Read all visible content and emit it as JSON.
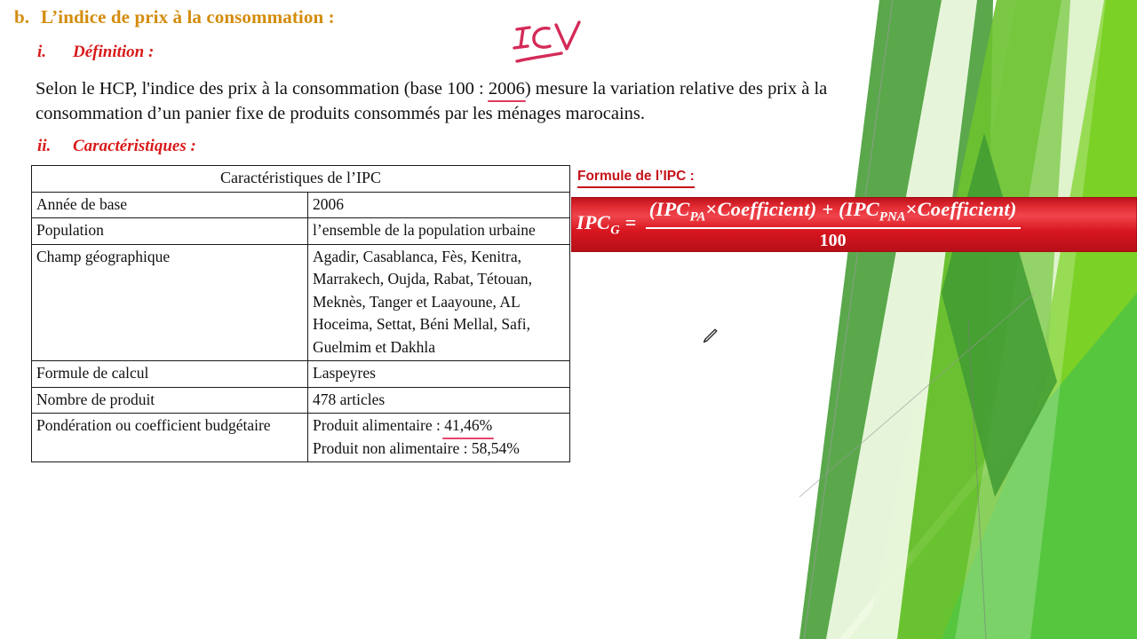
{
  "slide": {
    "heading": {
      "marker": "b.",
      "text": "L’indice de prix à la consommation :"
    },
    "sections": [
      {
        "numeral": "i.",
        "title": "Définition :"
      },
      {
        "numeral": "ii.",
        "title": "Caractéristiques :"
      }
    ],
    "definition": {
      "before": "Selon le HCP, l'indice des prix à la consommation (base 100 : ",
      "highlighted": "2006",
      "after": ") mesure la variation relative des prix à la consommation d’un panier fixe de produits consommés par les ménages marocains."
    },
    "table": {
      "caption": "Caractéristiques de l’IPC",
      "rows": [
        {
          "label": "Année de base",
          "value": "2006"
        },
        {
          "label": "Population",
          "value": "l’ensemble de la population urbaine"
        },
        {
          "label": "Champ géographique",
          "value": "Agadir, Casablanca, Fès, Kenitra, Marrakech, Oujda, Rabat, Tétouan, Meknès, Tanger et Laayoune, AL Hoceima, Settat, Béni Mellal, Safi, Guelmim et Dakhla"
        },
        {
          "label": "Formule de calcul",
          "value": "Laspeyres"
        },
        {
          "label": "Nombre de produit",
          "value": "478 articles"
        },
        {
          "label": "Pondération ou coefficient budgétaire",
          "value_line1_before": "Produit alimentaire : ",
          "value_line1_highlighted": "41,46%",
          "value_line2": "Produit non alimentaire : 58,54%"
        }
      ]
    },
    "formula": {
      "title": "Formule de l’IPC :",
      "lhs_main": "IPC",
      "lhs_sub": "G",
      "lhs_eq": " =",
      "numerator": {
        "open1": "(IPC",
        "sub1": "PA",
        "times1": "×",
        "word1": "Coefficient",
        "close1": ") + (IPC",
        "sub2": "PNA",
        "times2": "×",
        "word2": "Coefficient",
        "close2": ")"
      },
      "denominator": "100"
    },
    "annotations": {
      "handwriting": "ICV",
      "cursor": "pen-cursor"
    },
    "colors": {
      "heading": "#D48C0C",
      "section": "#D91A1A",
      "formula_red": "#C4121A",
      "annotation_pink": "#E03A62",
      "green_dark": "#5BA64C",
      "green_mid": "#56C53F",
      "green_bright": "#76D02C",
      "green_pale": "#D9F0C2"
    }
  }
}
